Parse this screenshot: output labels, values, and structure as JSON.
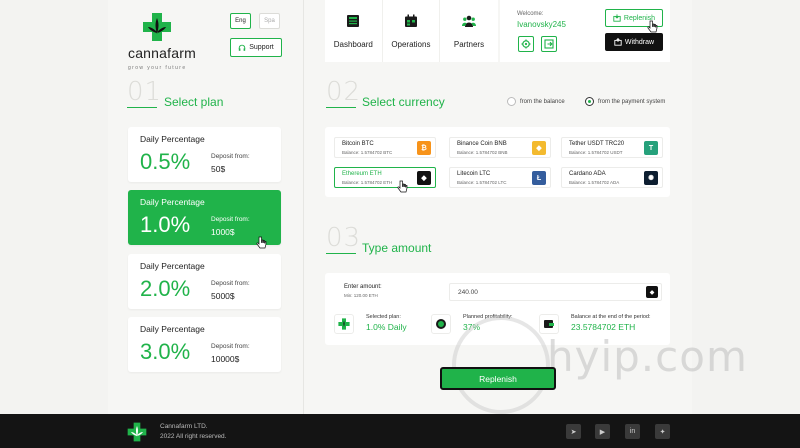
{
  "brand": {
    "name": "cannafarm",
    "tagline": "grow your future"
  },
  "languages": [
    {
      "label": "Eng",
      "active": true
    },
    {
      "label": "Spa",
      "active": false
    }
  ],
  "support_label": "Support",
  "nav": [
    {
      "label": "Dashboard",
      "icon": "dashboard-icon"
    },
    {
      "label": "Operations",
      "icon": "calendar-icon"
    },
    {
      "label": "Partners",
      "icon": "partners-icon"
    }
  ],
  "user": {
    "welcome": "Welcome:",
    "username": "Ivanovsky245",
    "replenish_label": "Replenish",
    "withdraw_label": "Withdraw"
  },
  "sections": {
    "plan": {
      "number": "01",
      "title": "Select plan"
    },
    "currency": {
      "number": "02",
      "title": "Select currency"
    },
    "amount": {
      "number": "03",
      "title": "Type amount"
    }
  },
  "plans": [
    {
      "title": "Daily Percentage",
      "percent": "0.5%",
      "deposit_label": "Deposit from:",
      "deposit_value": "50$",
      "selected": false
    },
    {
      "title": "Daily Percentage",
      "percent": "1.0%",
      "deposit_label": "Deposit from:",
      "deposit_value": "1000$",
      "selected": true
    },
    {
      "title": "Daily Percentage",
      "percent": "2.0%",
      "deposit_label": "Deposit from:",
      "deposit_value": "5000$",
      "selected": false
    },
    {
      "title": "Daily Percentage",
      "percent": "3.0%",
      "deposit_label": "Deposit from:",
      "deposit_value": "10000$",
      "selected": false
    }
  ],
  "payment_source": {
    "options": [
      "from the balance",
      "from the payment system"
    ],
    "selected": "from the payment system"
  },
  "currencies": [
    {
      "name": "Bitcoin BTC",
      "balance": "Balance: 1.5784702 BTC",
      "icon": "bitcoin-icon",
      "color": "#f7931a",
      "glyph": "₿",
      "selected": false
    },
    {
      "name": "Binance Coin BNB",
      "balance": "Balance: 1.5784702 BNB",
      "icon": "binance-icon",
      "color": "#f3ba2f",
      "glyph": "◆",
      "selected": false
    },
    {
      "name": "Tether USDT TRC20",
      "balance": "Balance: 1.5784702 USDT",
      "icon": "tether-icon",
      "color": "#26a17b",
      "glyph": "T",
      "selected": false
    },
    {
      "name": "Ethereum ETH",
      "balance": "Balance: 1.5784702 ETH",
      "icon": "ethereum-icon",
      "color": "#111111",
      "glyph": "◆",
      "selected": true
    },
    {
      "name": "Litecoin LTC",
      "balance": "Balance: 1.5784702 LTC",
      "icon": "litecoin-icon",
      "color": "#345d9d",
      "glyph": "Ł",
      "selected": false
    },
    {
      "name": "Cardano ADA",
      "balance": "Balance: 1.5784702 ADA",
      "icon": "cardano-icon",
      "color": "#0d1e30",
      "glyph": "✺",
      "selected": false
    }
  ],
  "amount": {
    "label": "Enter amount:",
    "min": "Min: 120.00 ETH",
    "value": "240.00",
    "stats": [
      {
        "label": "Selected plan:",
        "value": "1.0% Daily",
        "icon": "leaf-icon"
      },
      {
        "label": "Planned profitability:",
        "value": "37%",
        "icon": "percent-icon"
      },
      {
        "label": "Balance at the end of the period:",
        "value": "23.5784702 ETH",
        "icon": "wallet-icon"
      }
    ]
  },
  "replenish_button": "Replenish",
  "watermark": "hyip.com",
  "footer": {
    "company": "Cannafarm LTD.",
    "copyright": "2022 All right reserved.",
    "social": [
      {
        "icon": "telegram-icon",
        "glyph": "➤"
      },
      {
        "icon": "youtube-icon",
        "glyph": "▶"
      },
      {
        "icon": "linkedin-icon",
        "glyph": "in"
      },
      {
        "icon": "twitter-icon",
        "glyph": "✦"
      }
    ]
  },
  "colors": {
    "accent": "#20b34a",
    "dark": "#111111",
    "background": "#f3f3f1"
  }
}
